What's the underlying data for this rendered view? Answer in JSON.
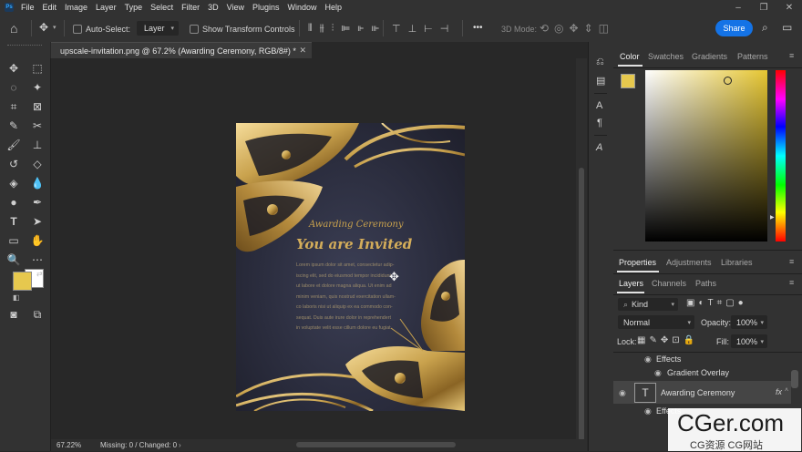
{
  "menu": {
    "app_icon": "ps-logo",
    "items": [
      "File",
      "Edit",
      "Image",
      "Layer",
      "Type",
      "Select",
      "Filter",
      "3D",
      "View",
      "Plugins",
      "Window",
      "Help"
    ]
  },
  "options": {
    "auto_select_label": "Auto-Select:",
    "layer_select_value": "Layer",
    "show_transform_label": "Show Transform Controls",
    "more_label": "•••",
    "mode_3d_label": "3D Mode:",
    "share_label": "Share"
  },
  "document": {
    "tab_title": "upscale-invitation.png @ 67.2% (Awarding Ceremony, RGB/8#) *",
    "heading_script": "Awarding Ceremony",
    "invite_title": "You are Invited",
    "body_lines": [
      "Lorem ipsum dolor sit amet, consectetur adip-",
      "iscing elit, sed do eiusmod tempor incididunt",
      "ut labore et dolore magna aliqua. Ut enim ad",
      "minim veniam, quis nostrud exercitation ullam-",
      "co laboris nisi ut aliquip ex ea commodo con-",
      "sequat. Duis aute irure dolor in reprehendert",
      "in voluptate velit esse cillum dolore eu fugiat"
    ]
  },
  "status": {
    "zoom": "67.22%",
    "info": "Missing: 0 / Changed: 0"
  },
  "colors": {
    "foreground": "#e6c84e",
    "background": "#ffffff",
    "accent": "#1473e6",
    "gold": "#c9a24d"
  },
  "color_panel": {
    "tabs": [
      "Color",
      "Swatches",
      "Gradients",
      "Patterns"
    ],
    "active": "Color"
  },
  "properties_panel": {
    "tabs": [
      "Properties",
      "Adjustments",
      "Libraries"
    ]
  },
  "layers_panel": {
    "tabs": [
      "Layers",
      "Channels",
      "Paths"
    ],
    "filter_kind": "Kind",
    "blend_mode": "Normal",
    "opacity_label": "Opacity:",
    "opacity_value": "100%",
    "lock_label": "Lock:",
    "fill_label": "Fill:",
    "fill_value": "100%",
    "rows": [
      {
        "label": "Effects"
      },
      {
        "label": "Gradient Overlay"
      },
      {
        "label": "Awarding Ceremony",
        "fx": "fx"
      },
      {
        "label": "Effects"
      }
    ]
  },
  "watermark": {
    "main": "CGer.com",
    "sub": "CG资源 CG网站"
  }
}
